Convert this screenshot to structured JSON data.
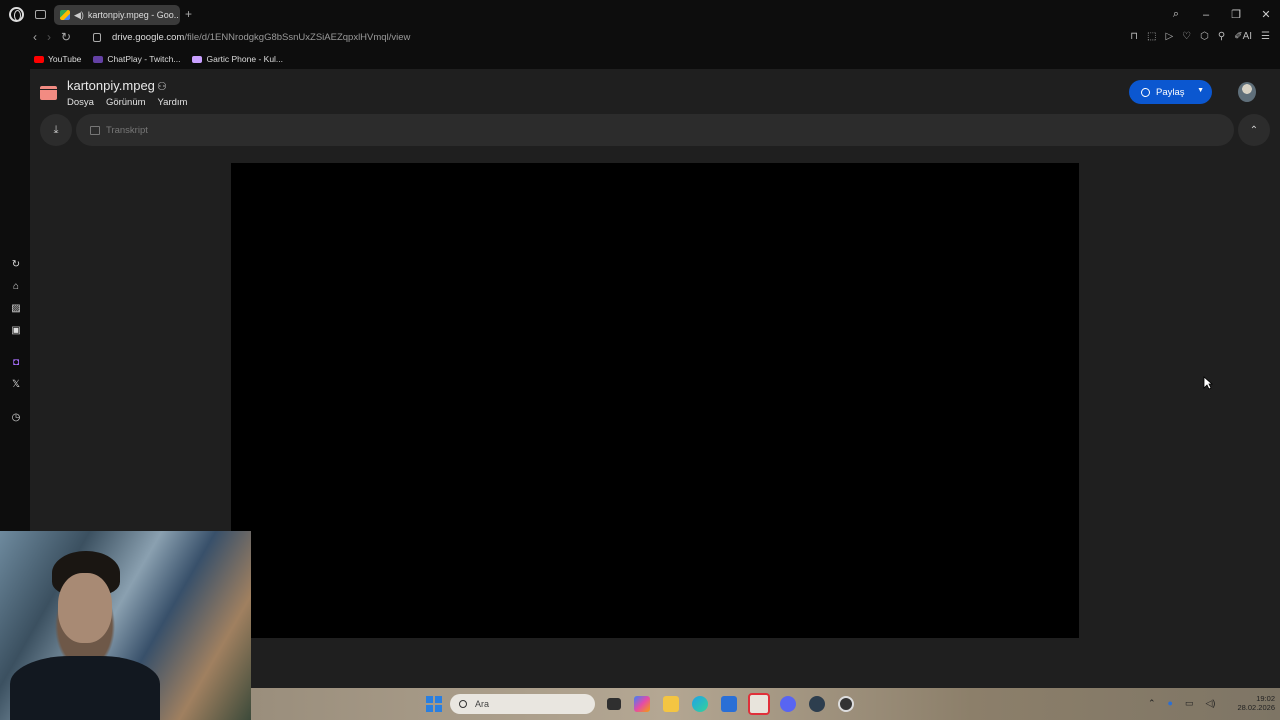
{
  "browser": {
    "tab_title": "kartonpiy.mpeg - Goo...",
    "url_host": "drive.google.com",
    "url_path": "/file/d/1ENNrodgkgG8bSsnUxZSiAEZqpxlHVmql/view",
    "bookmarks": [
      {
        "label": "YouTube",
        "color": "#ff0000"
      },
      {
        "label": "ChatPlay - Twitch...",
        "color": "#6441a5"
      },
      {
        "label": "Gartic Phone - Kul...",
        "color": "#c9a0ff"
      }
    ]
  },
  "viewer": {
    "file_name": "kartonpiy.mpeg",
    "menu": [
      "Dosya",
      "Görünüm",
      "Yardım"
    ],
    "share_label": "Paylaş",
    "transcript_label": "Transkript"
  },
  "taskbar": {
    "search_placeholder": "Ara",
    "time": "19:02",
    "date": "28.02.2026"
  },
  "colors": {
    "accent": "#0b57d0",
    "file_icon": "#f28b82"
  }
}
